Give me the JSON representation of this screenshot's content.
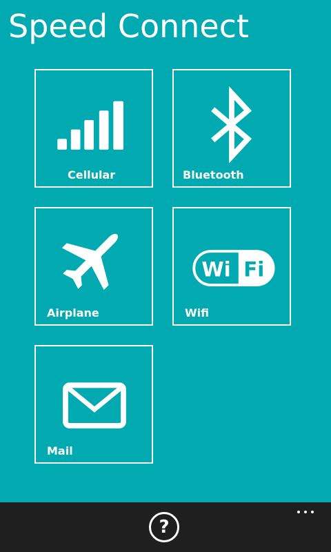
{
  "app": {
    "title": "Speed Connect"
  },
  "tiles": [
    {
      "label": "Cellular",
      "icon": "cellular-signal-icon"
    },
    {
      "label": "Bluetooth",
      "icon": "bluetooth-icon"
    },
    {
      "label": "Airplane",
      "icon": "airplane-icon"
    },
    {
      "label": "Wifi",
      "icon": "wifi-icon"
    },
    {
      "label": "Mail",
      "icon": "mail-icon"
    }
  ],
  "appbar": {
    "help_label": "?",
    "more_icon": "more-dots-icon"
  },
  "colors": {
    "background": "#00aab0",
    "appbar": "#1f1f1f",
    "foreground": "#ffffff"
  }
}
